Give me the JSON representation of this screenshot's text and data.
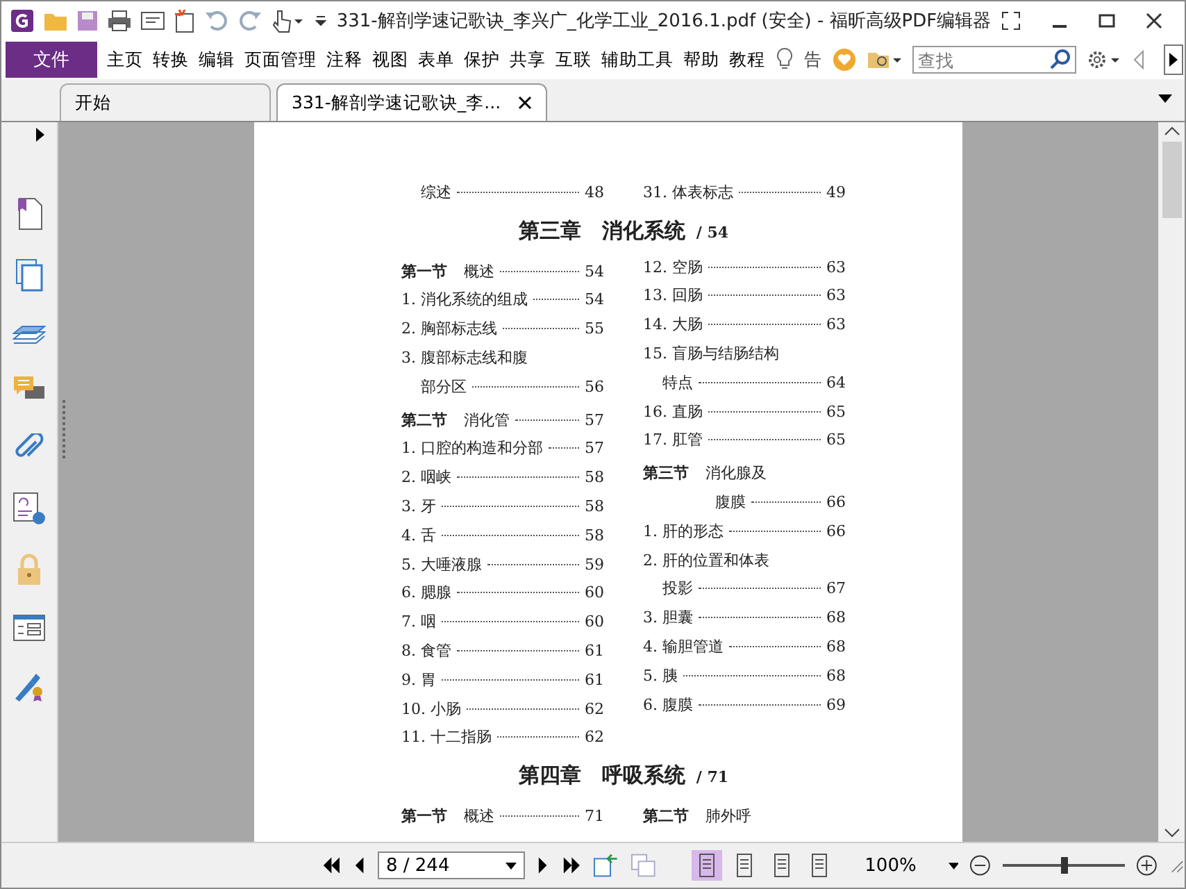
{
  "window": {
    "title": "331-解剖学速记歌诀_李兴广_化学工业_2016.1.pdf (安全) - 福昕高级PDF编辑器"
  },
  "menu": {
    "file": "文件",
    "items": [
      {
        "label": "主页"
      },
      {
        "label": "转换"
      },
      {
        "label": "编辑"
      },
      {
        "label": "页面管理"
      },
      {
        "label": "注释"
      },
      {
        "label": "视图"
      },
      {
        "label": "表单"
      },
      {
        "label": "保护"
      },
      {
        "label": "共享"
      },
      {
        "label": "互联"
      },
      {
        "label": "辅助工具"
      },
      {
        "label": "帮助"
      },
      {
        "label": "教程"
      }
    ],
    "tell_me": "告",
    "search": {
      "placeholder": "查找"
    }
  },
  "tabs": [
    {
      "label": "开始",
      "selected": false
    },
    {
      "label": "331-解剖学速记歌诀_李...",
      "selected": true
    }
  ],
  "document": {
    "blocks": [
      {
        "kind": "columns",
        "left": [
          {
            "kind": "cont",
            "label": "综述",
            "page": "48"
          }
        ],
        "right": [
          {
            "kind": "item",
            "label": "31. 体表标志",
            "page": "49"
          }
        ]
      },
      {
        "kind": "heading",
        "title": "第三章　消化系统",
        "page": "/ 54"
      },
      {
        "kind": "columns",
        "left": [
          {
            "kind": "section",
            "num": "第一节",
            "label": "概述",
            "page": "54"
          },
          {
            "kind": "item",
            "label": "1. 消化系统的组成",
            "page": "54"
          },
          {
            "kind": "item",
            "label": "2. 胸部标志线",
            "page": "55"
          },
          {
            "kind": "item",
            "label": "3. 腹部标志线和腹"
          },
          {
            "kind": "cont",
            "label": "部分区",
            "page": "56"
          },
          {
            "kind": "section",
            "num": "第二节",
            "label": "消化管",
            "page": "57"
          },
          {
            "kind": "item",
            "label": "1. 口腔的构造和分部",
            "page": "57"
          },
          {
            "kind": "item",
            "label": "2. 咽峡",
            "page": "58"
          },
          {
            "kind": "item",
            "label": "3. 牙",
            "page": "58"
          },
          {
            "kind": "item",
            "label": "4. 舌",
            "page": "58"
          },
          {
            "kind": "item",
            "label": "5. 大唾液腺",
            "page": "59"
          },
          {
            "kind": "item",
            "label": "6. 腮腺",
            "page": "60"
          },
          {
            "kind": "item",
            "label": "7. 咽",
            "page": "60"
          },
          {
            "kind": "item",
            "label": "8. 食管",
            "page": "61"
          },
          {
            "kind": "item",
            "label": "9. 胃",
            "page": "61"
          },
          {
            "kind": "item",
            "label": "10. 小肠",
            "page": "62"
          },
          {
            "kind": "item",
            "label": "11. 十二指肠",
            "page": "62"
          }
        ],
        "right": [
          {
            "kind": "item",
            "label": "12. 空肠",
            "page": "63"
          },
          {
            "kind": "item",
            "label": "13. 回肠",
            "page": "63"
          },
          {
            "kind": "item",
            "label": "14. 大肠",
            "page": "63"
          },
          {
            "kind": "item",
            "label": "15. 盲肠与结肠结构"
          },
          {
            "kind": "cont",
            "label": "特点",
            "page": "64"
          },
          {
            "kind": "item",
            "label": "16. 直肠",
            "page": "65"
          },
          {
            "kind": "item",
            "label": "17. 肛管",
            "page": "65"
          },
          {
            "kind": "section",
            "num": "第三节",
            "label": "消化腺及"
          },
          {
            "kind": "section_cont",
            "label": "腹膜",
            "page": "66"
          },
          {
            "kind": "item",
            "label": "1. 肝的形态",
            "page": "66"
          },
          {
            "kind": "item",
            "label": "2. 肝的位置和体表"
          },
          {
            "kind": "cont",
            "label": "投影",
            "page": "67"
          },
          {
            "kind": "item",
            "label": "3. 胆囊",
            "page": "68"
          },
          {
            "kind": "item",
            "label": "4. 输胆管道",
            "page": "68"
          },
          {
            "kind": "item",
            "label": "5. 胰",
            "page": "68"
          },
          {
            "kind": "item",
            "label": "6. 腹膜",
            "page": "69"
          }
        ]
      },
      {
        "kind": "heading",
        "title": "第四章　呼吸系统",
        "page": "/ 71"
      },
      {
        "kind": "columns",
        "left": [
          {
            "kind": "section",
            "num": "第一节",
            "label": "概述",
            "page": "71"
          }
        ],
        "right": [
          {
            "kind": "section",
            "num": "第二节",
            "label": "肺外呼"
          }
        ]
      }
    ]
  },
  "status_bar": {
    "page_field": "8 / 244",
    "zoom": "100%",
    "zoom_slider": {
      "level": 0.5
    },
    "layouts": [
      {
        "selected": true
      },
      {
        "selected": false
      },
      {
        "selected": false
      },
      {
        "selected": false
      }
    ]
  }
}
